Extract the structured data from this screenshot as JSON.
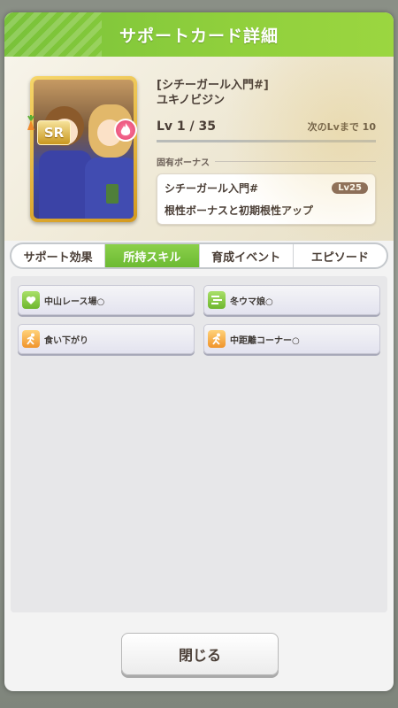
{
  "modal": {
    "title": "サポートカード詳細"
  },
  "card": {
    "title": "[シチーガール入門#]",
    "name": "ユキノビジン",
    "rarity": "SR",
    "level": "Lv 1 / 35",
    "next_level_label": "次のLvまで 10",
    "rarity_icon": "sr-badge",
    "type_icon": "flame-icon",
    "type_color": "#e2456f"
  },
  "unique_bonus": {
    "section_label": "固有ボーナス",
    "name": "シチーガール入門#",
    "level_badge": "Lv25",
    "description": "根性ボーナスと初期根性アップ"
  },
  "tabs": [
    {
      "label": "サポート効果",
      "active": false
    },
    {
      "label": "所持スキル",
      "active": true
    },
    {
      "label": "育成イベント",
      "active": false
    },
    {
      "label": "エピソード",
      "active": false
    }
  ],
  "skills": [
    {
      "name": "中山レース場○",
      "icon": "heart-icon",
      "color": "green"
    },
    {
      "name": "冬ウマ娘○",
      "icon": "speed-lines-icon",
      "color": "green"
    },
    {
      "name": "食い下がり",
      "icon": "runner-icon",
      "color": "orange"
    },
    {
      "name": "中距離コーナー○",
      "icon": "runner-icon",
      "color": "orange"
    }
  ],
  "close_button": {
    "label": "閉じる"
  },
  "colors": {
    "accent": "#79c23a",
    "brand_green": "#8fcf3c",
    "text": "#4a3e36"
  }
}
